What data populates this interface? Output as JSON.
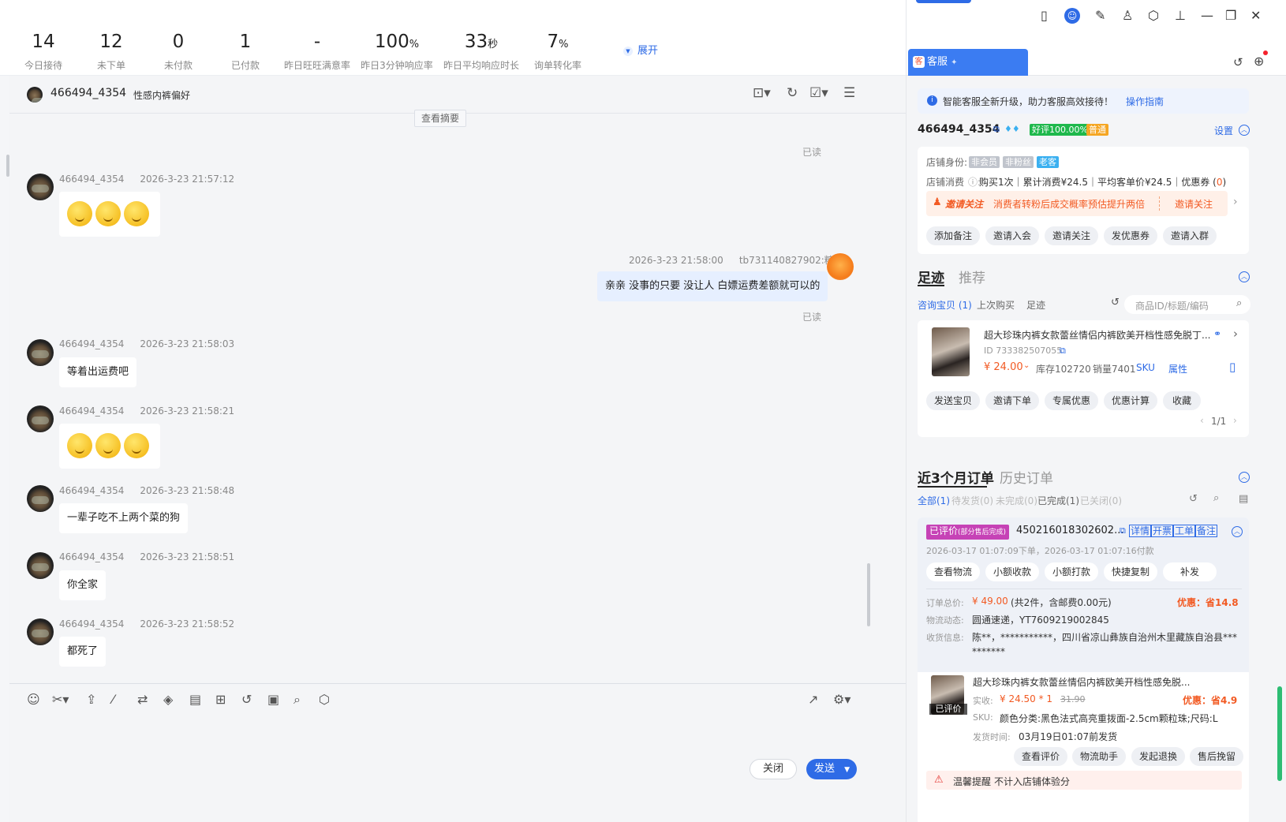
{
  "stats": [
    {
      "value": "14",
      "unit": "",
      "label": "今日接待"
    },
    {
      "value": "12",
      "unit": "",
      "label": "未下单"
    },
    {
      "value": "0",
      "unit": "",
      "label": "未付款"
    },
    {
      "value": "1",
      "unit": "",
      "label": "已付款"
    },
    {
      "value": "-",
      "unit": "",
      "label": "昨日旺旺满意率"
    },
    {
      "value": "100",
      "unit": "%",
      "label": "昨日3分钟响应率"
    },
    {
      "value": "33",
      "unit": "秒",
      "label": "昨日平均响应时长"
    },
    {
      "value": "7",
      "unit": "%",
      "label": "询单转化率"
    }
  ],
  "expand_label": "展开",
  "chat": {
    "customer_name": "466494_4354",
    "customer_tag": "性感内裤偏好",
    "summary_btn": "查看摘要",
    "read_label": "已读",
    "messages": [
      {
        "sender": "466494_4354",
        "time": "2026-3-23 21:57:12",
        "text": "🤭🤭🤭",
        "emoji": true
      },
      {
        "sender": "tb731140827902:糖糖",
        "time": "2026-3-23 21:58:00",
        "text": "亲亲 没事的只要 没让人  白嫖运费差额就可以的",
        "me": true
      },
      {
        "sender": "466494_4354",
        "time": "2026-3-23 21:58:03",
        "text": "等着出运费吧"
      },
      {
        "sender": "466494_4354",
        "time": "2026-3-23 21:58:21",
        "text": "🤭🤭🤭",
        "emoji": true
      },
      {
        "sender": "466494_4354",
        "time": "2026-3-23 21:58:48",
        "text": "一辈子吃不上两个菜的狗"
      },
      {
        "sender": "466494_4354",
        "time": "2026-3-23 21:58:51",
        "text": "你全家"
      },
      {
        "sender": "466494_4354",
        "time": "2026-3-23 21:58:52",
        "text": "都死了"
      }
    ],
    "close_btn": "关闭",
    "send_btn": "发送"
  },
  "panel": {
    "tab_label": "客服",
    "notice": "智能客服全新升级，助力客服高效接待！",
    "notice_link": "操作指南",
    "customer_id": "466494_4354",
    "good_rate": "好评100.00%",
    "level": "普通",
    "settings": "设置",
    "shop_identity_label": "店铺身份:",
    "identity_tags": [
      "非会员",
      "非粉丝",
      "老客"
    ],
    "shop_spend_label": "店铺消费",
    "shop_spend_text": "购买1次｜累计消费¥24.5｜平均客单价¥24.5｜优惠券 (",
    "coupon_count": "0",
    "coupon_close": ")",
    "invite_title": "邀请关注",
    "invite_text": "消费者转粉后成交概率预估提升两倍",
    "invite_action": "邀请关注",
    "actions1": [
      "添加备注",
      "邀请入会",
      "邀请关注",
      "发优惠券",
      "邀请入群"
    ],
    "footprint_tab": "足迹",
    "recommend_tab": "推荐",
    "sub_tabs": [
      "咨询宝贝 (1)",
      "上次购买",
      "足迹"
    ],
    "search_placeholder": "商品ID/标题/编码",
    "product": {
      "title": "超大珍珠内裤女款蕾丝情侣内裤欧美开档性感免脱丁...",
      "id": "ID 733382507055",
      "price": "¥ 24.00",
      "stock": "库存102720",
      "sales": "销量7401",
      "sku": "SKU",
      "attr": "属性"
    },
    "actions2": [
      "发送宝贝",
      "邀请下单",
      "专属优惠",
      "优惠计算",
      "收藏"
    ],
    "pager": "1/1",
    "orders_tab": "近3个月订单",
    "history_tab": "历史订单",
    "order_filters": [
      "全部(1)",
      "待发货(0)",
      "未完成(0)",
      "已完成(1)",
      "已关闭(0)"
    ],
    "order": {
      "status": "已评价",
      "status_sub": "(部分售后完成)",
      "number": "450216018302602...",
      "links": [
        "详情",
        "开票",
        "工单",
        "备注"
      ],
      "time": "2026-03-17 01:07:09下单，2026-03-17 01:07:16付款",
      "actions": [
        "查看物流",
        "小额收款",
        "小额打款",
        "快捷复制",
        "补发"
      ],
      "total_label": "订单总价:",
      "total_value": "¥ 49.00",
      "total_extra": "(共2件，含邮费0.00元)",
      "discount": "优惠：省14.8",
      "logistics_label": "物流动态:",
      "logistics_value": "圆通速递，YT7609219002845",
      "address_label": "收货信息:",
      "address_value": "陈**，***********，四川省凉山彝族自治州木里藏族自治县**********",
      "item_title": "超大珍珠内裤女款蕾丝情侣内裤欧美开档性感免脱...",
      "item_badge": "已评价",
      "item_paid_label": "实收:",
      "item_paid": "¥ 24.50 * 1",
      "item_orig": "31.90",
      "item_discount": "优惠：省4.9",
      "item_sku_label": "SKU:",
      "item_sku": "颜色分类:黑色法式高亮重拨面-2.5cm颗粒珠;尺码:L",
      "ship_label": "发货时间:",
      "ship_value": "03月19日01:07前发货",
      "item_actions": [
        "查看评价",
        "物流助手",
        "发起退换",
        "售后挽留"
      ]
    },
    "tip_title": "温馨提醒",
    "tip_text": "不计入店铺体验分"
  },
  "colors": {
    "accent": "#2e6be6",
    "price": "#f25a23",
    "status_tag": "#c642b6"
  }
}
